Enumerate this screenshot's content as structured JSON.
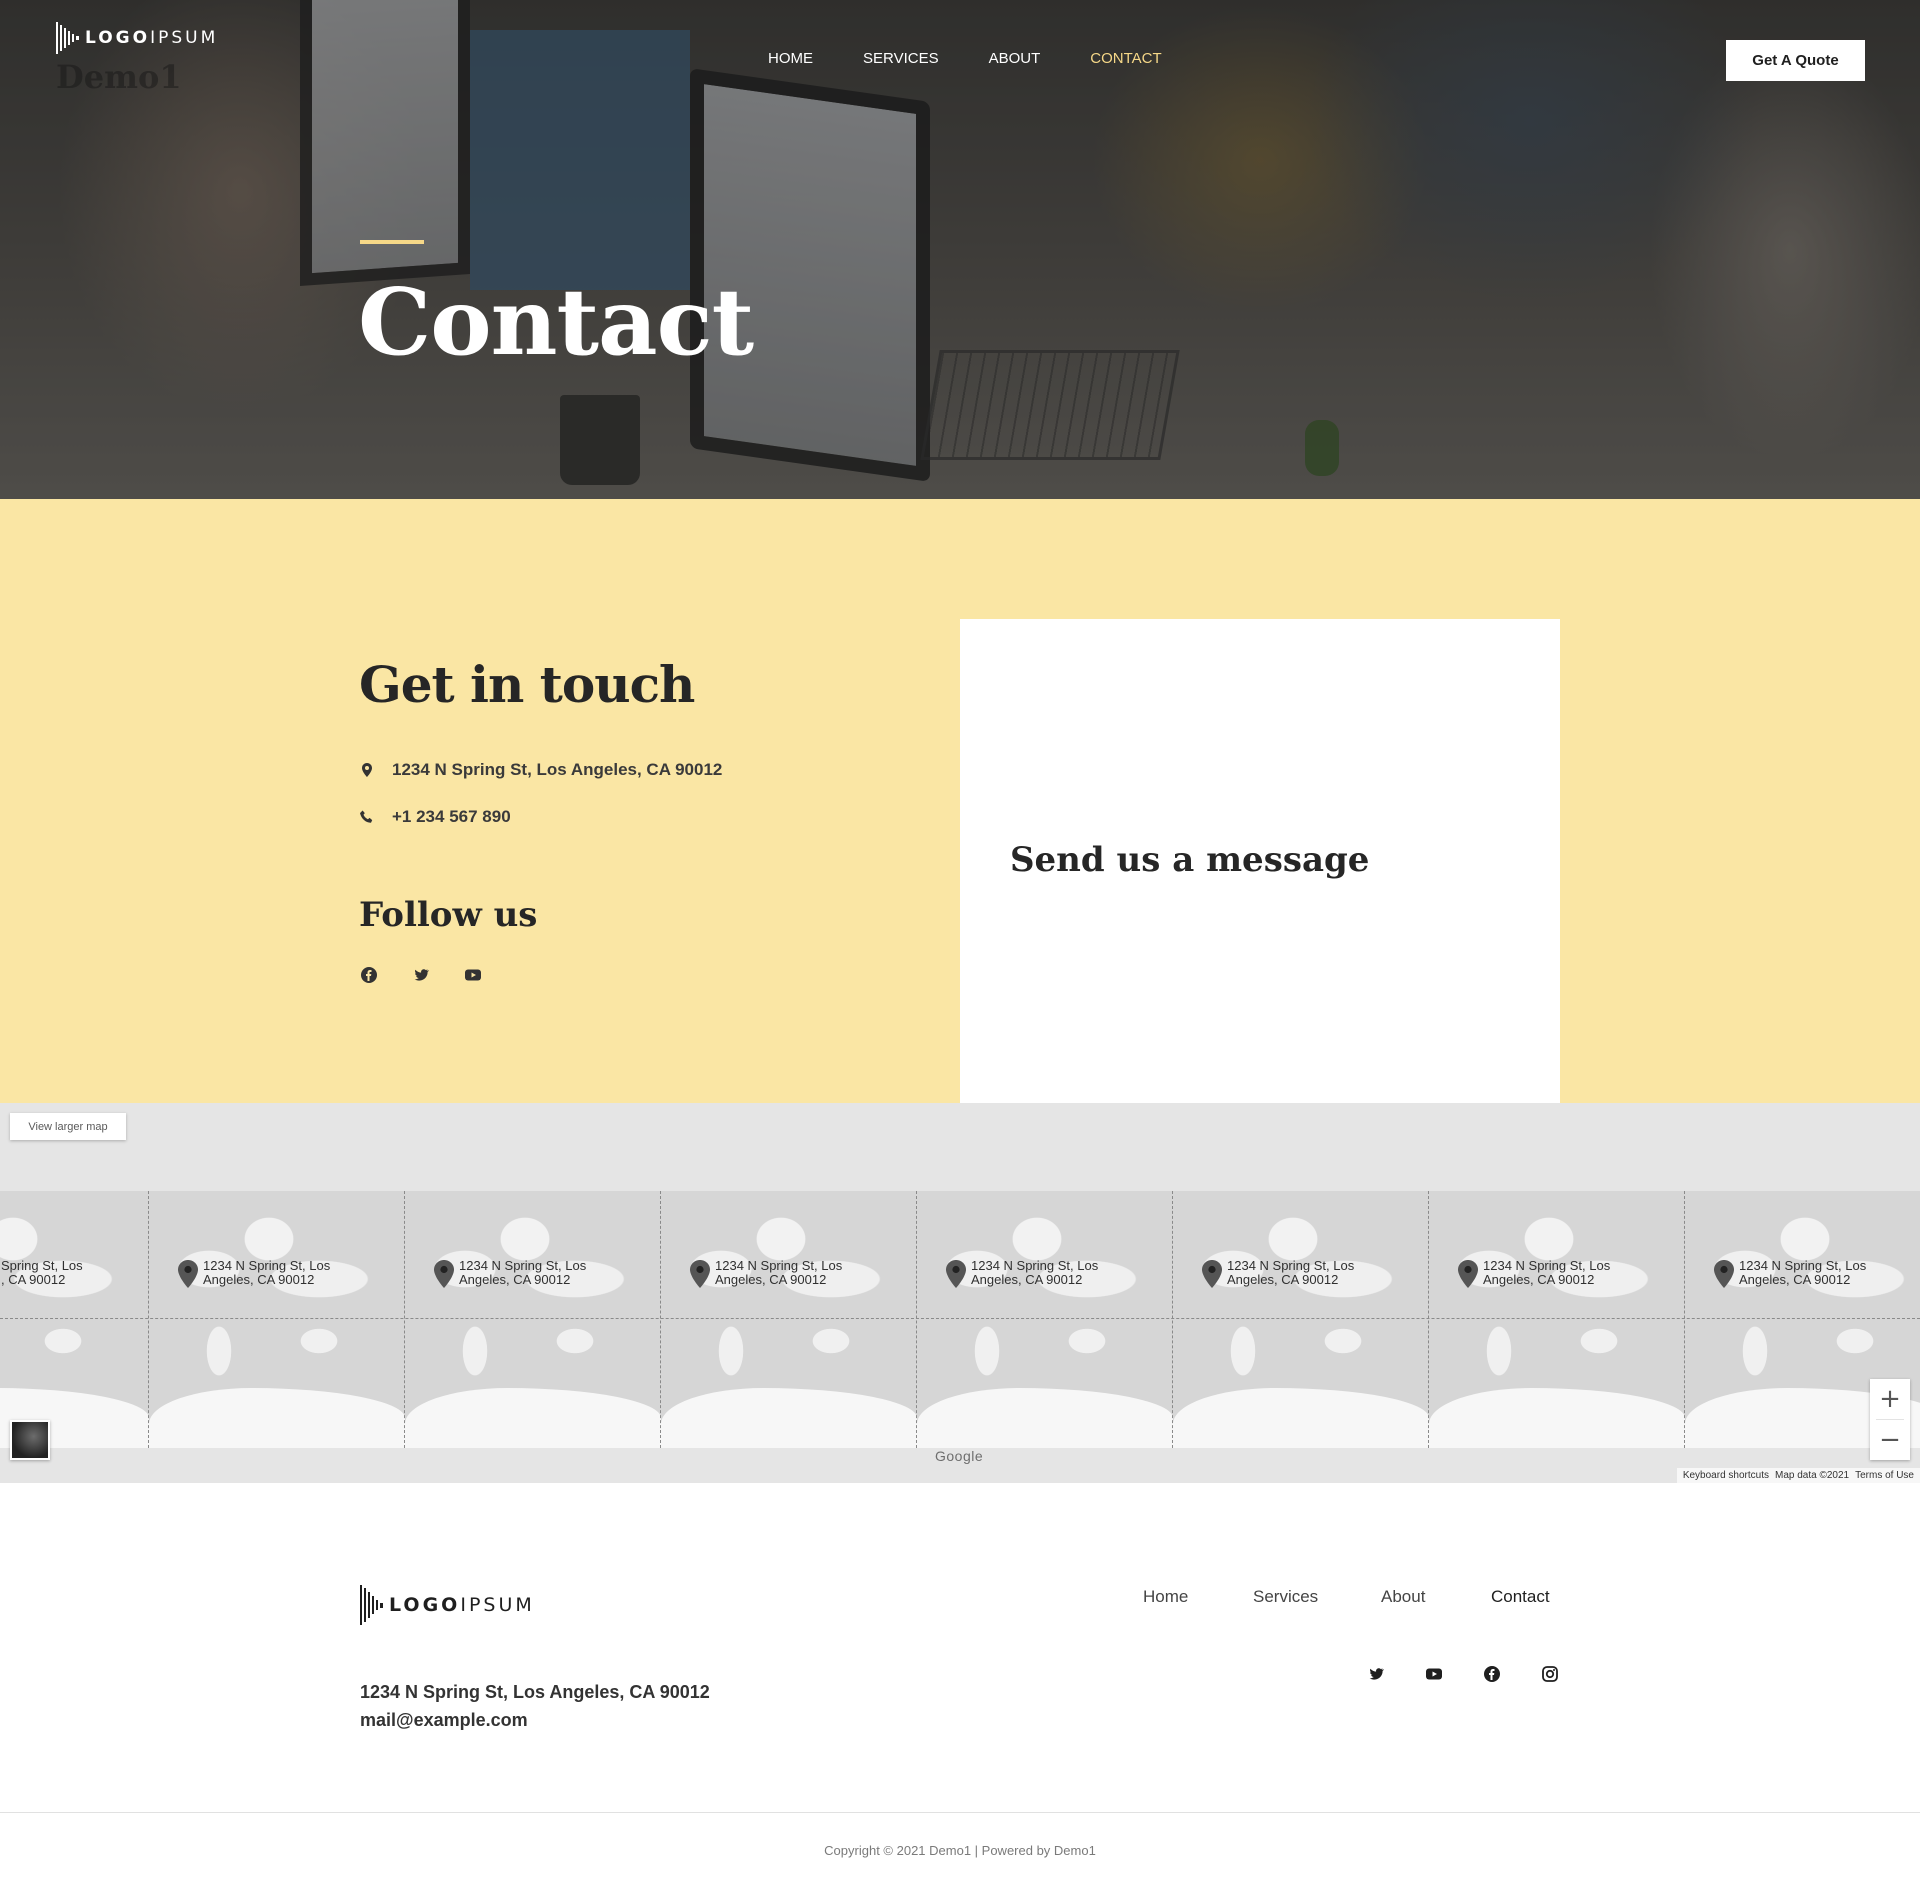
{
  "header": {
    "logo_text_bold": "LOGO",
    "logo_text_light": "IPSUM",
    "ghost_text": "Demo1",
    "nav": [
      {
        "label": "HOME"
      },
      {
        "label": "SERVICES"
      },
      {
        "label": "ABOUT"
      },
      {
        "label": "CONTACT",
        "active": true
      }
    ],
    "quote_button": "Get A Quote"
  },
  "hero": {
    "title": "Contact"
  },
  "contact": {
    "heading": "Get in touch",
    "address": "1234 N Spring St, Los Angeles, CA 90012",
    "phone": "+1 234 567 890",
    "follow_heading": "Follow us",
    "follow_icons": [
      "facebook-icon",
      "twitter-icon",
      "youtube-icon"
    ],
    "form_heading": "Send us a message"
  },
  "map": {
    "view_larger": "View larger map",
    "pin_label_line1": "1234 N Spring St, Los",
    "pin_label_line2": "Angeles, CA 90012",
    "edge_label_line1": "Spring St, Los",
    "edge_label_line2": ", CA 90012",
    "google_text": "Google",
    "zoom_in": "+",
    "zoom_out": "−",
    "keyboard_shortcuts": "Keyboard shortcuts",
    "map_data": "Map data ©2021",
    "terms": "Terms of Use"
  },
  "footer": {
    "logo_text_bold": "LOGO",
    "logo_text_light": "IPSUM",
    "address": "1234 N Spring St, Los Angeles, CA 90012",
    "email": "mail@example.com",
    "nav": [
      {
        "label": "Home"
      },
      {
        "label": "Services"
      },
      {
        "label": "About"
      },
      {
        "label": "Contact",
        "active": true
      }
    ],
    "social_icons": [
      "twitter-icon",
      "youtube-icon",
      "facebook-icon",
      "instagram-icon"
    ],
    "copyright": "Copyright © 2021 Demo1 | Powered by Demo1"
  },
  "colors": {
    "accent_yellow": "#f6d888",
    "section_background": "#fae6a4",
    "text_dark": "#262626"
  }
}
